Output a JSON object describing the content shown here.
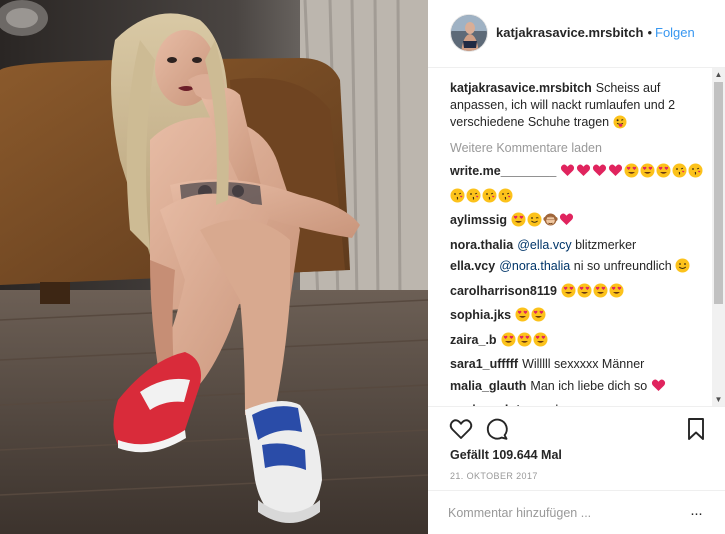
{
  "post": {
    "username": "katjakrasavice.mrsbitch",
    "follow_label": "Folgen",
    "separator": "•",
    "caption_text": "Scheiss auf anpassen, ich will nackt rumlaufen und 2 verschiedene Schuhe tragen",
    "caption_emoji": "😛",
    "load_more": "Weitere Kommentare laden",
    "likes": "Gefällt 109.644 Mal",
    "timestamp": "21. OKTOBER 2017",
    "comment_placeholder": "Kommentar hinzufügen ...",
    "more_label": "···"
  },
  "comments": [
    {
      "user": "write.me________",
      "text": "",
      "emoji": [
        "heart",
        "heart",
        "heart",
        "heart",
        "hearteyes",
        "hearteyes",
        "hearteyes",
        "kiss",
        "kiss",
        "kiss",
        "kiss",
        "kiss",
        "kiss"
      ]
    },
    {
      "user": "aylimssig",
      "text": "",
      "emoji": [
        "hearteyes-small",
        "wink",
        "monkey",
        "heart"
      ]
    },
    {
      "user": "nora.thalia",
      "mention": "@ella.vcy",
      "text": "blitzmerker",
      "emoji": []
    },
    {
      "user": "ella.vcy",
      "mention": "@nora.thalia",
      "text": "ni so unfreundlich",
      "emoji": [
        "smile"
      ]
    },
    {
      "user": "carolharrison8119",
      "text": "",
      "emoji": [
        "hearteyes",
        "hearteyes",
        "hearteyes",
        "hearteyes"
      ]
    },
    {
      "user": "sophia.jks",
      "text": "",
      "emoji": [
        "hearteyes",
        "hearteyes"
      ]
    },
    {
      "user": "zaira_.b",
      "text": "",
      "emoji": [
        "hearteyes",
        "hearteyes",
        "hearteyes"
      ]
    },
    {
      "user": "sara1_ufffff",
      "text": "Willlll sexxxxx Männer",
      "emoji": []
    },
    {
      "user": "malia_glauth",
      "text": "Man ich liebe dich so",
      "emoji": [
        "heart"
      ]
    },
    {
      "user": "soniquevb",
      "text": "Legend",
      "emoji": []
    }
  ],
  "icons": {
    "like": "heart-outline-icon",
    "comment": "speech-bubble-icon",
    "save": "bookmark-icon",
    "more": "more-dots-icon"
  },
  "colors": {
    "accent": "#3897f0",
    "text": "#262626",
    "muted": "#999999",
    "heart": "#e0245e",
    "emoji_face": "#fcc21b"
  }
}
